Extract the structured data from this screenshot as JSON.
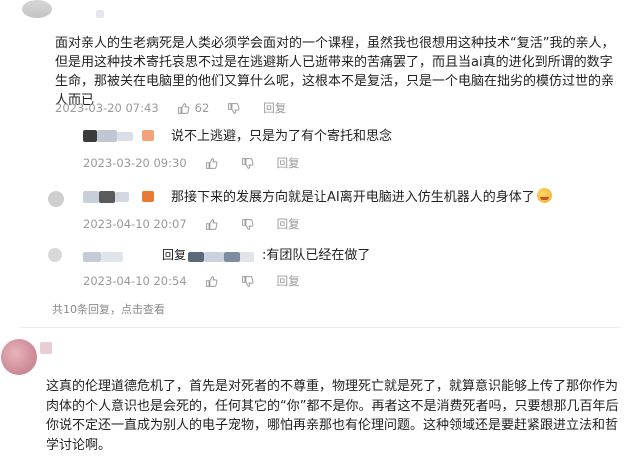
{
  "comments": [
    {
      "text": "面对亲人的生老病死是人类必须学会面对的一个课程，虽然我也很想用这种技术“复活”我的亲人，但是用这种技术寄托哀思不过是在逃避斯人已逝带来的苦痛罢了，而且当ai真的进化到所谓的数字生命，那被关在电脑里的他们又算什么呢，这根本不是复活，只是一个电脑在拙劣的模仿过世的亲人而已",
      "date": "2023-03-20 07:43",
      "likes": "62",
      "reply_label": "回复",
      "replies": [
        {
          "text": "说不上逃避，只是为了有个寄托和思念",
          "date": "2023-03-20 09:30",
          "reply_label": "回复"
        },
        {
          "text": "那接下来的发展方向就是让AI离开电脑进入仿生机器人的身体了",
          "date": "2023-04-10 20:07",
          "reply_label": "回复"
        },
        {
          "prefix": "回复",
          "text": ":有团队已经在做了",
          "date": "2023-04-10 20:54",
          "reply_label": "回复"
        }
      ],
      "more_replies": "共10条回复，",
      "view_more": "点击查看"
    },
    {
      "text": "这真的伦理道德危机了，首先是对死者的不尊重，物理死亡就是死了，就算意识能够上传了那你作为肉体的个人意识也是会死的，任何其它的“你”都不是你。再者这不是消费死者吗，只要想那几百年后你说不定还一直成为别人的电子宠物，哪怕再亲那也有伦理问题。这种领域还是要赶紧跟进立法和哲学讨论啊。"
    }
  ],
  "icons": {
    "like": "thumbs-up-icon",
    "dislike": "thumbs-down-icon"
  },
  "colors": {
    "text": "#222222",
    "meta": "#9a9a9a",
    "accent": "#f07b3f"
  }
}
